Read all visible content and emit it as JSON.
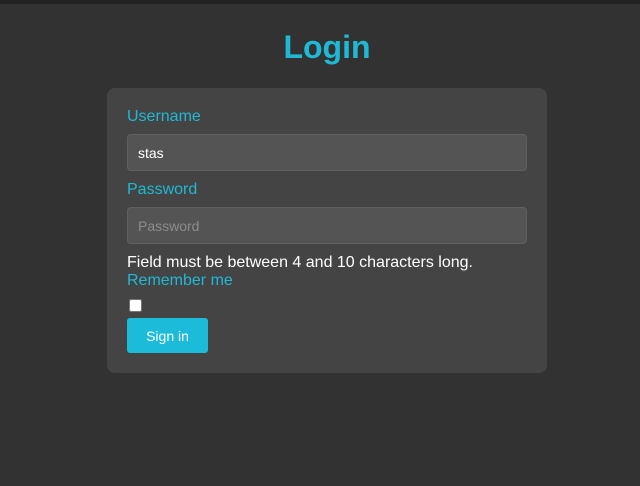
{
  "page": {
    "title": "Login"
  },
  "form": {
    "username_label": "Username",
    "username_value": "stas",
    "password_label": "Password",
    "password_placeholder": "Password",
    "error_message": "Field must be between 4 and 10 characters long.",
    "remember_label": "Remember me",
    "remember_checked": false,
    "submit_label": "Sign in"
  },
  "colors": {
    "background": "#323232",
    "card": "#444444",
    "accent": "#1fb9d6",
    "button": "#1cbbd9"
  }
}
